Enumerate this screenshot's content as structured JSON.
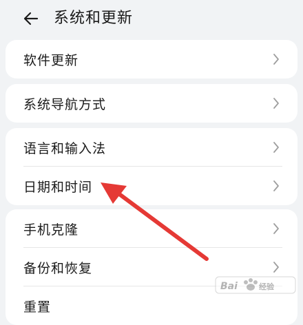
{
  "header": {
    "title": "系统和更新",
    "back_icon": "arrow-left-icon"
  },
  "groups": [
    {
      "items": [
        {
          "label": "软件更新"
        }
      ]
    },
    {
      "items": [
        {
          "label": "系统导航方式"
        }
      ]
    },
    {
      "items": [
        {
          "label": "语言和输入法"
        },
        {
          "label": "日期和时间"
        }
      ]
    },
    {
      "items": [
        {
          "label": "手机克隆"
        },
        {
          "label": "备份和恢复"
        },
        {
          "label": "重置"
        }
      ]
    }
  ],
  "annotation": {
    "arrow_color": "#e53935"
  },
  "watermark": {
    "text": "Baidu经验"
  },
  "colors": {
    "background": "#f1f3f5",
    "card": "#ffffff",
    "chevron": "#9e9e9e"
  }
}
